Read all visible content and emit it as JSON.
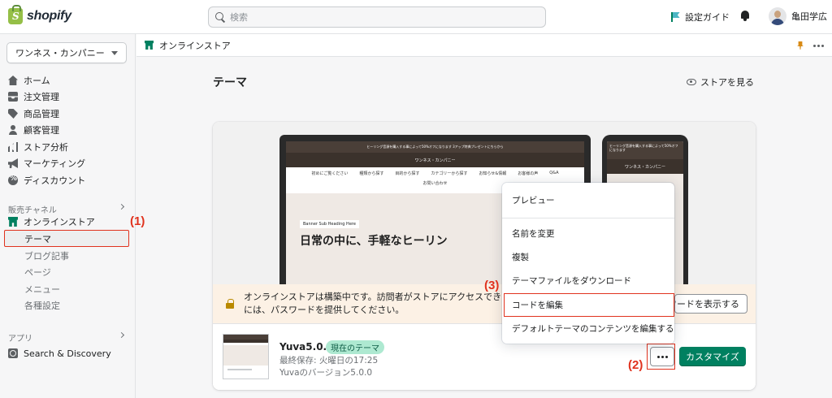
{
  "topbar": {
    "brand": "shopify",
    "search_placeholder": "検索",
    "setup_guide": "設定ガイド",
    "user_name": "亀田学広"
  },
  "sidebar": {
    "store_name": "ワンネス・カンパニー",
    "main_items": [
      {
        "label": "ホーム",
        "icon": "home-icon"
      },
      {
        "label": "注文管理",
        "icon": "orders-icon"
      },
      {
        "label": "商品管理",
        "icon": "tag-icon"
      },
      {
        "label": "顧客管理",
        "icon": "person-icon"
      },
      {
        "label": "ストア分析",
        "icon": "bar-chart-icon"
      },
      {
        "label": "マーケティング",
        "icon": "megaphone-icon"
      },
      {
        "label": "ディスカウント",
        "icon": "discount-icon"
      }
    ],
    "channels_label": "販売チャネル",
    "online_store": "オンラインストア",
    "sub_items": [
      "テーマ",
      "ブログ記事",
      "ページ",
      "メニュー",
      "各種設定"
    ],
    "apps_label": "アプリ",
    "app_item": "Search & Discovery"
  },
  "page_bar": {
    "title": "オンラインストア"
  },
  "main": {
    "title": "テーマ",
    "view_store": "ストアを見る"
  },
  "preview": {
    "desktop_banner": "ヒーリング音源を購入する事によって50%オフになります 3アップ特典プレゼントにちらから",
    "desktop_store": "ワンネス・カンパニー",
    "desktop_nav": [
      "初めにご覧ください",
      "種類から探す",
      "目的から探す",
      "カテゴリーから探す",
      "お知らせ&情報",
      "お客様の声",
      "Q&A",
      "お問い合わせ"
    ],
    "hero_sub": "Banner Sub Heading Here",
    "hero_title": "日常の中に、手軽なヒーリン",
    "phone_banner": "ヒーリング音源を購入する事によって50%オフになります",
    "phone_store": "ワンネス・カンパニー"
  },
  "notice": {
    "text_line1": "オンラインストアは構築中です。訪問者がストアにアクセスできるよう",
    "text_line2": "には、パスワードを提供してください。",
    "button": "ワードを表示する"
  },
  "theme": {
    "name": "Yuva5.0.0",
    "badge": "現在のテーマ",
    "last_saved": "最終保存: 火曜日の17:25",
    "version": "Yuvaのバージョン5.0.0",
    "customize": "カスタマイズ"
  },
  "dropdown": {
    "items": [
      "プレビュー",
      "名前を変更",
      "複製",
      "テーマファイルをダウンロード",
      "コードを編集",
      "デフォルトテーマのコンテンツを編集する"
    ]
  },
  "annotations": [
    "(1)",
    "(2)",
    "(3)"
  ],
  "colors": {
    "accent_green": "#008060",
    "annotation_red": "#e0321e",
    "notice_bg": "#fcf1e5"
  }
}
